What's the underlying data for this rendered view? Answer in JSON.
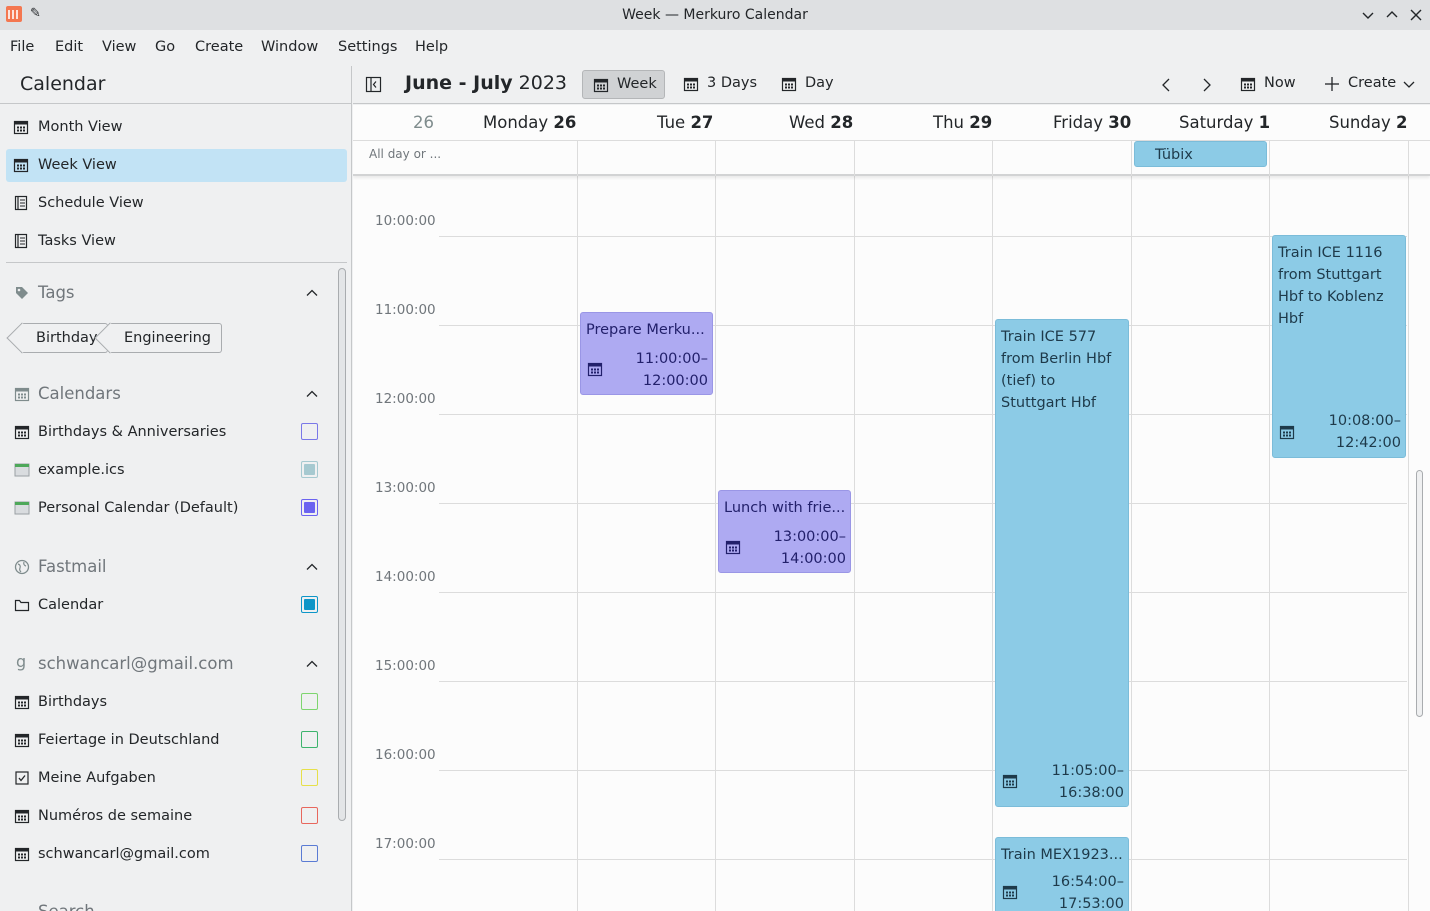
{
  "window": {
    "title": "Week — Merkuro Calendar"
  },
  "menu": [
    "File",
    "Edit",
    "View",
    "Go",
    "Create",
    "Window",
    "Settings",
    "Help"
  ],
  "sidebar": {
    "header": "Calendar",
    "views": [
      {
        "label": "Month View",
        "icon": "calendar-month-icon"
      },
      {
        "label": "Week View",
        "icon": "calendar-week-icon",
        "active": true
      },
      {
        "label": "Schedule View",
        "icon": "schedule-list-icon"
      },
      {
        "label": "Tasks View",
        "icon": "tasks-list-icon"
      }
    ],
    "tags": {
      "title": "Tags",
      "items": [
        "Birthday",
        "Engineering"
      ]
    },
    "calendars": {
      "title": "Calendars",
      "items": [
        {
          "label": "Birthdays & Anniversaries",
          "color": "#7a78e8",
          "checked": false
        },
        {
          "label": "example.ics",
          "color": "#a6c9d0",
          "checked": true
        },
        {
          "label": "Personal Calendar (Default)",
          "color": "#6b63f0",
          "checked": true
        }
      ]
    },
    "fastmail": {
      "title": "Fastmail",
      "items": [
        {
          "label": "Calendar",
          "color": "#0d96c8",
          "checked": true
        }
      ]
    },
    "gmail": {
      "title": "schwancarl@gmail.com",
      "items": [
        {
          "label": "Birthdays",
          "color": "#7ed56f",
          "checked": false
        },
        {
          "label": "Feiertage in Deutschland",
          "color": "#3db46d",
          "checked": false
        },
        {
          "label": "Meine Aufgaben",
          "color": "#e6e04a",
          "checked": false
        },
        {
          "label": "Numéros de semaine",
          "color": "#e8675d",
          "checked": false
        },
        {
          "label": "schwancarl@gmail.com",
          "color": "#5a7bd4",
          "checked": false
        }
      ]
    },
    "next_section_partial": "Search"
  },
  "toolbar": {
    "month_bold": "June - July",
    "year": "2023",
    "views": [
      "Week",
      "3 Days",
      "Day"
    ],
    "now": "Now",
    "create": "Create"
  },
  "week": {
    "week_number": "26",
    "days": [
      {
        "name": "Monday",
        "num": "26"
      },
      {
        "name": "Tue",
        "num": "27"
      },
      {
        "name": "Wed",
        "num": "28"
      },
      {
        "name": "Thu",
        "num": "29"
      },
      {
        "name": "Friday",
        "num": "30"
      },
      {
        "name": "Saturday",
        "num": "1"
      },
      {
        "name": "Sunday",
        "num": "2"
      }
    ],
    "allday_label": "All day or ...",
    "allday_events": [
      {
        "title": "Tübix",
        "day": 5,
        "color": "#8ccbe6"
      }
    ],
    "times": [
      "10:00:00",
      "11:00:00",
      "12:00:00",
      "13:00:00",
      "14:00:00",
      "15:00:00",
      "16:00:00",
      "17:00:00"
    ],
    "events": [
      {
        "title": "Prepare Merku...",
        "start": "11:00:00–",
        "end": "12:00:00",
        "style": "purple"
      },
      {
        "title": "Lunch with frie...",
        "start": "13:00:00–",
        "end": "14:00:00",
        "style": "purple"
      },
      {
        "title": "Train ICE 577 from Berlin Hbf (tief) to Stuttgart Hbf",
        "start": "11:05:00–",
        "end": "16:38:00",
        "style": "blue"
      },
      {
        "title": "Train MEX1923...",
        "start": "16:54:00–",
        "end": "17:53:00",
        "style": "blue"
      },
      {
        "title": "Train ICE 1116 from Stuttgart Hbf to Koblenz Hbf",
        "start": "10:08:00–",
        "end": "12:42:00",
        "style": "blue"
      }
    ]
  }
}
